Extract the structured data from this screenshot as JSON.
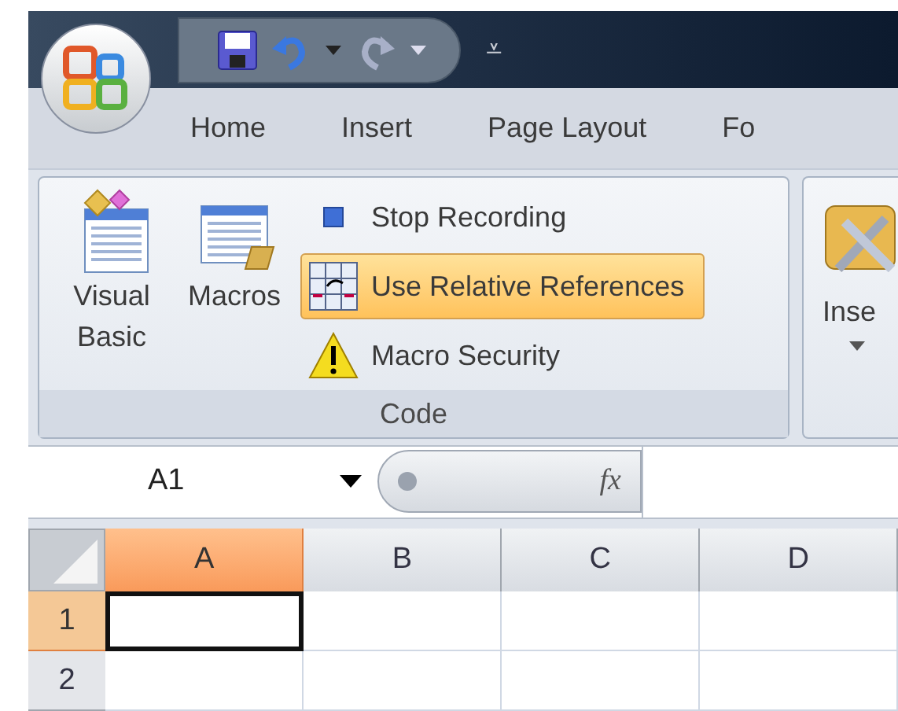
{
  "quick_access": {
    "overflow_glyph": "⩡"
  },
  "tabs": [
    {
      "label": "Home",
      "selected": false
    },
    {
      "label": "Insert",
      "selected": false
    },
    {
      "label": "Page Layout",
      "selected": false
    },
    {
      "label": "Fo",
      "selected": false
    }
  ],
  "code_group": {
    "title": "Code",
    "large_buttons": [
      {
        "label": "Visual Basic",
        "kind": "vb"
      },
      {
        "label": "Macros",
        "kind": "macros"
      }
    ],
    "small_buttons": [
      {
        "label": "Stop Recording",
        "kind": "stop",
        "selected": false
      },
      {
        "label": "Use Relative References",
        "kind": "relative",
        "selected": true
      },
      {
        "label": "Macro Security",
        "kind": "security",
        "selected": false
      }
    ]
  },
  "next_group": {
    "label": "Inse"
  },
  "formula_bar": {
    "name_box": "A1",
    "fx": "fx"
  },
  "columns": [
    {
      "label": "A",
      "selected": true
    },
    {
      "label": "B",
      "selected": false
    },
    {
      "label": "C",
      "selected": false
    },
    {
      "label": "D",
      "selected": false
    }
  ],
  "rows": [
    {
      "label": "1",
      "selected": true
    },
    {
      "label": "2",
      "selected": false
    }
  ]
}
